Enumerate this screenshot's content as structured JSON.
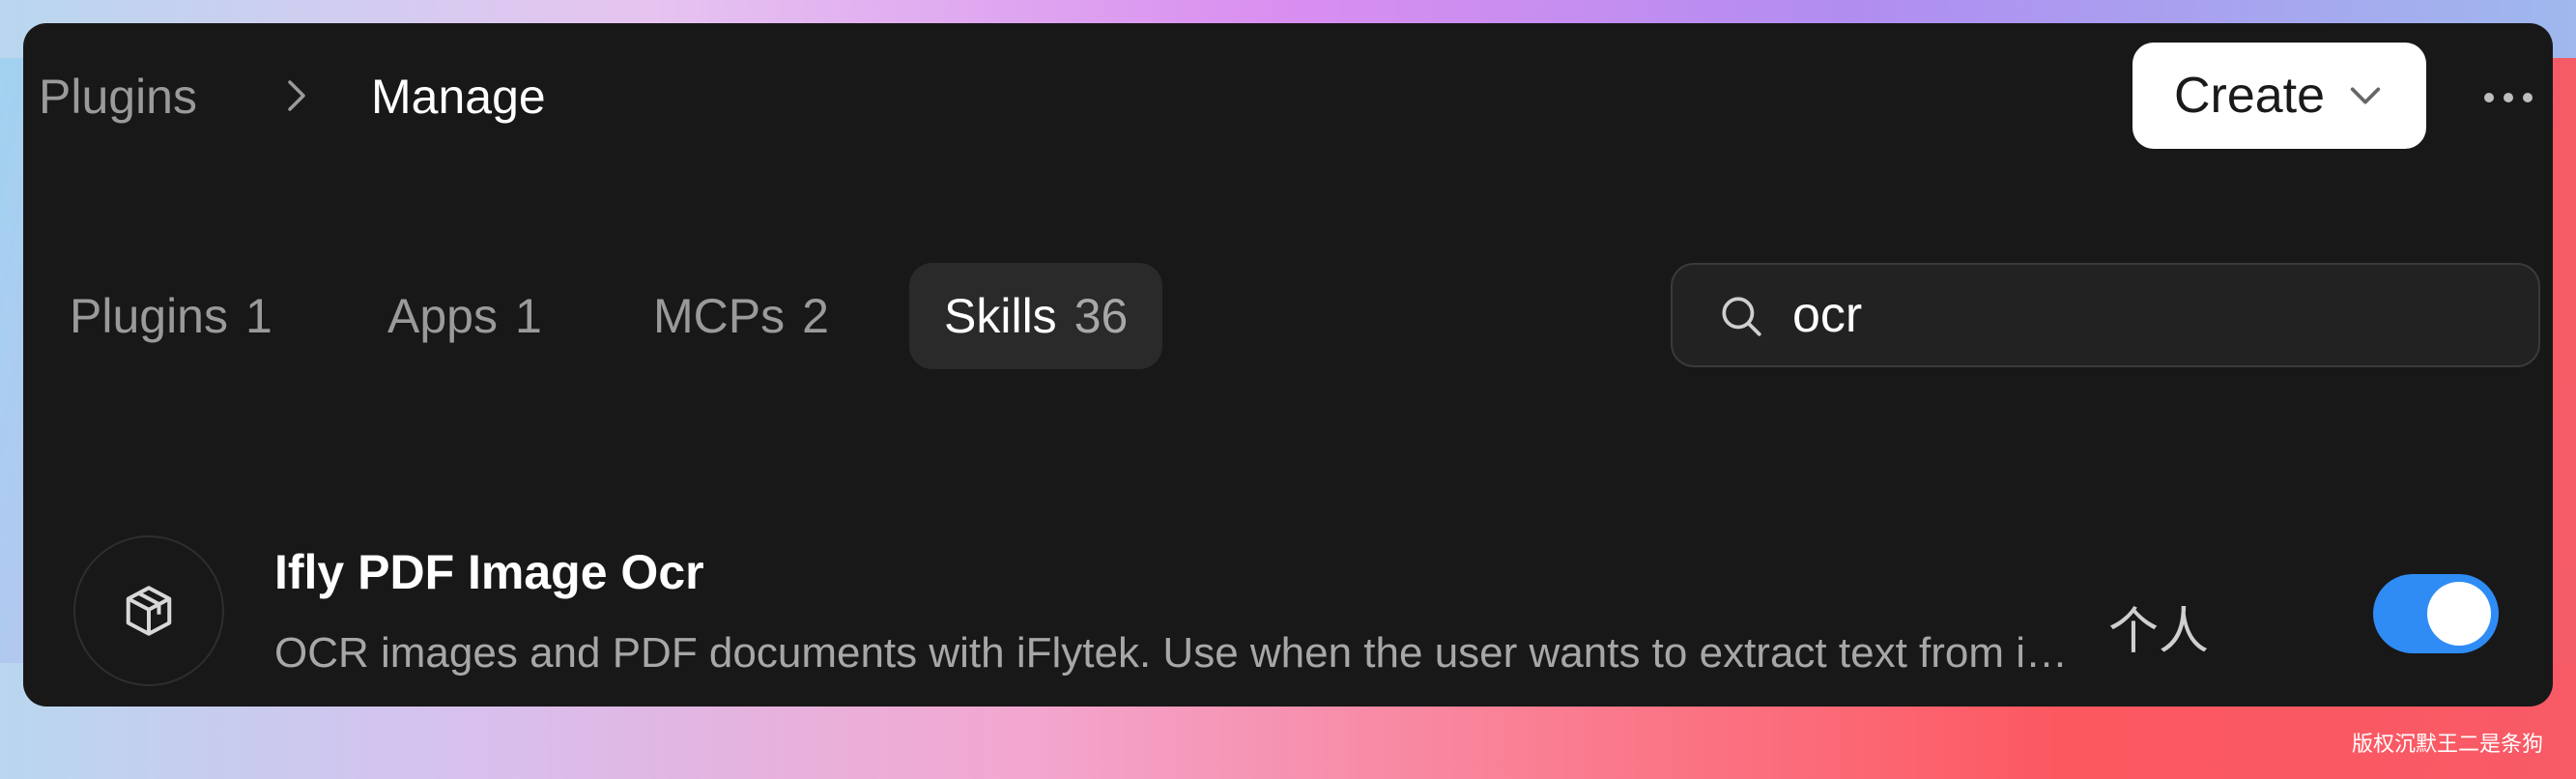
{
  "breadcrumb": {
    "root": "Plugins",
    "current": "Manage"
  },
  "header": {
    "create_label": "Create"
  },
  "tabs": [
    {
      "label": "Plugins",
      "count": "1"
    },
    {
      "label": "Apps",
      "count": "1"
    },
    {
      "label": "MCPs",
      "count": "2"
    },
    {
      "label": "Skills",
      "count": "36"
    }
  ],
  "active_tab": "Skills",
  "search": {
    "value": "ocr"
  },
  "skills": [
    {
      "title": "Ifly PDF Image Ocr",
      "description": "OCR images and PDF documents with iFlytek. Use when the user wants to extract text from images or PDF files",
      "scope": "个人",
      "enabled": true
    }
  ],
  "watermark": "版权沉默王二是条狗",
  "colors": {
    "window_bg": "#181818",
    "accent_toggle": "#2f8cf5",
    "create_button_bg": "#ffffff"
  },
  "icons": {
    "breadcrumb_separator": "chevron-right-icon",
    "create_dropdown": "chevron-down-icon",
    "more": "more-horizontal-icon",
    "search": "search-icon",
    "skill": "cube-icon"
  }
}
